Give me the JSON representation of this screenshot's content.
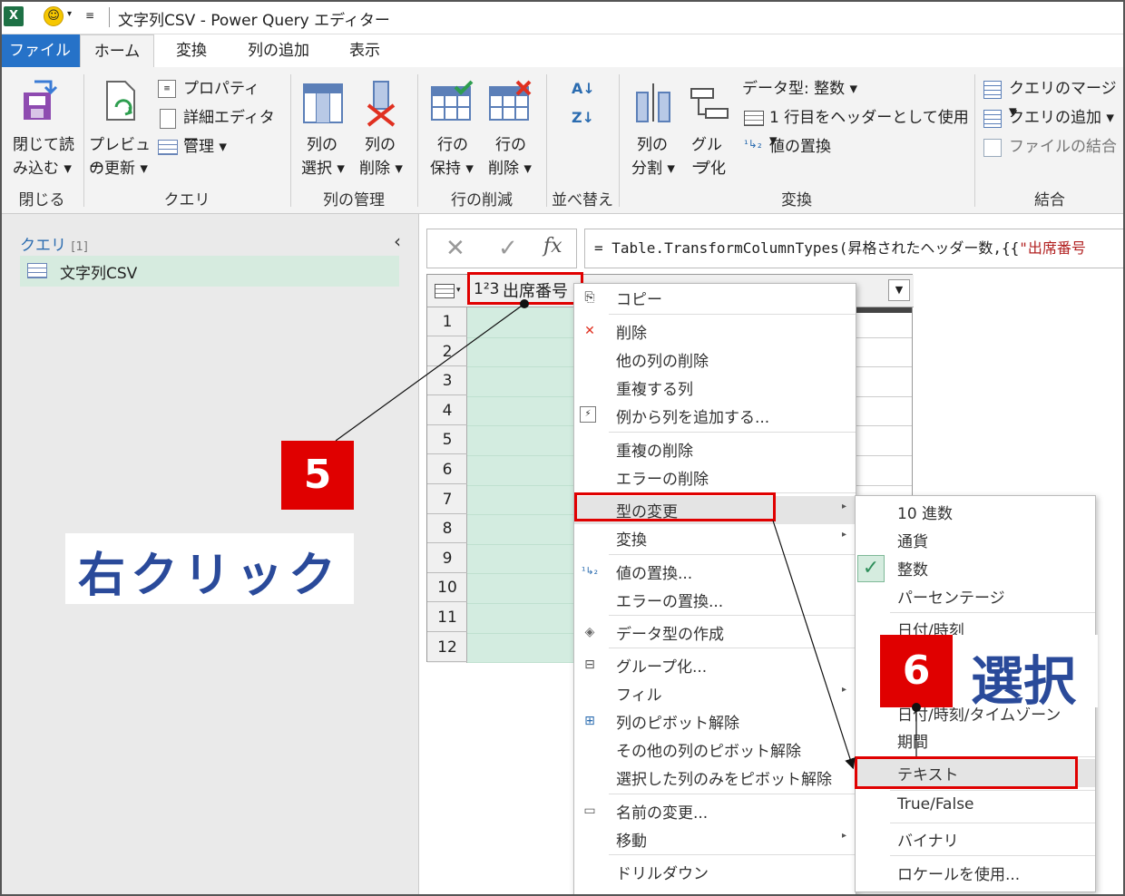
{
  "window": {
    "app_icon": "X",
    "title": "文字列CSV - Power Query エディター"
  },
  "tabs": [
    "ファイル",
    "ホーム",
    "変換",
    "列の追加",
    "表示"
  ],
  "ribbon": {
    "close_load": [
      "閉じて読",
      "み込む ▾"
    ],
    "refresh_preview": [
      "プレビュー",
      "の更新 ▾"
    ],
    "properties": "プロパティ",
    "advanced_editor": "詳細エディター",
    "manage": "管理 ▾",
    "choose_columns": [
      "列の",
      "選択 ▾"
    ],
    "remove_columns": [
      "列の",
      "削除 ▾"
    ],
    "keep_rows": [
      "行の",
      "保持 ▾"
    ],
    "remove_rows": [
      "行の",
      "削除 ▾"
    ],
    "sort_asc": "A↓",
    "sort_desc": "Z↓",
    "split_column": [
      "列の",
      "分割 ▾"
    ],
    "group_by": [
      "グルー",
      "プ化"
    ],
    "data_type": "データ型: 整数 ▾",
    "use_first_row": "1 行目をヘッダーとして使用 ▾",
    "replace_values": "値の置換",
    "merge_queries": "クエリのマージ ▾",
    "append_queries": "クエリの追加 ▾",
    "combine_files": "ファイルの結合",
    "groups": [
      "閉じる",
      "クエリ",
      "列の管理",
      "行の削減",
      "並べ替え",
      "変換",
      "結合"
    ]
  },
  "left_pane": {
    "label": "クエリ",
    "count": "[1]",
    "query_name": "文字列CSV"
  },
  "formula": {
    "prefix": "= Table.TransformColumnTypes(昇格されたヘッダー数,{{",
    "red_part": "\"出席番号"
  },
  "grid": {
    "column_type": "1²3",
    "column_name": "出席番号",
    "row_numbers": [
      "1",
      "2",
      "3",
      "4",
      "5",
      "6",
      "7",
      "8",
      "9",
      "10",
      "11",
      "12"
    ]
  },
  "context_menu": {
    "copy": "コピー",
    "remove": "削除",
    "remove_other": "他の列の削除",
    "duplicate": "重複する列",
    "add_from_examples": "例から列を追加する...",
    "remove_duplicates": "重複の削除",
    "remove_errors": "エラーの削除",
    "change_type": "型の変更",
    "transform": "変換",
    "replace_values": "値の置換...",
    "replace_errors": "エラーの置換...",
    "create_data_type": "データ型の作成",
    "group_by": "グループ化...",
    "fill": "フィル",
    "unpivot": "列のピボット解除",
    "unpivot_other": "その他の列のピボット解除",
    "unpivot_selected": "選択した列のみをピボット解除",
    "rename": "名前の変更...",
    "move": "移動",
    "drill_down": "ドリルダウン"
  },
  "sub_menu": {
    "decimal": "10 進数",
    "currency": "通貨",
    "integer": "整数",
    "percentage": "パーセンテージ",
    "datetime": "日付/時刻",
    "datetime_zone": "日付/時刻/タイムゾーン",
    "duration": "期間",
    "text": "テキスト",
    "boolean": "True/False",
    "binary": "バイナリ",
    "locale": "ロケールを使用..."
  },
  "annotations": {
    "step5": "5",
    "right_click": "右クリック",
    "step6": "6",
    "select": "選択"
  },
  "colors": {
    "file_tab": "#2672c8",
    "highlight_red": "#e00000",
    "selected_column": "#d3ece0",
    "annotation_text": "#2a4a9a"
  }
}
